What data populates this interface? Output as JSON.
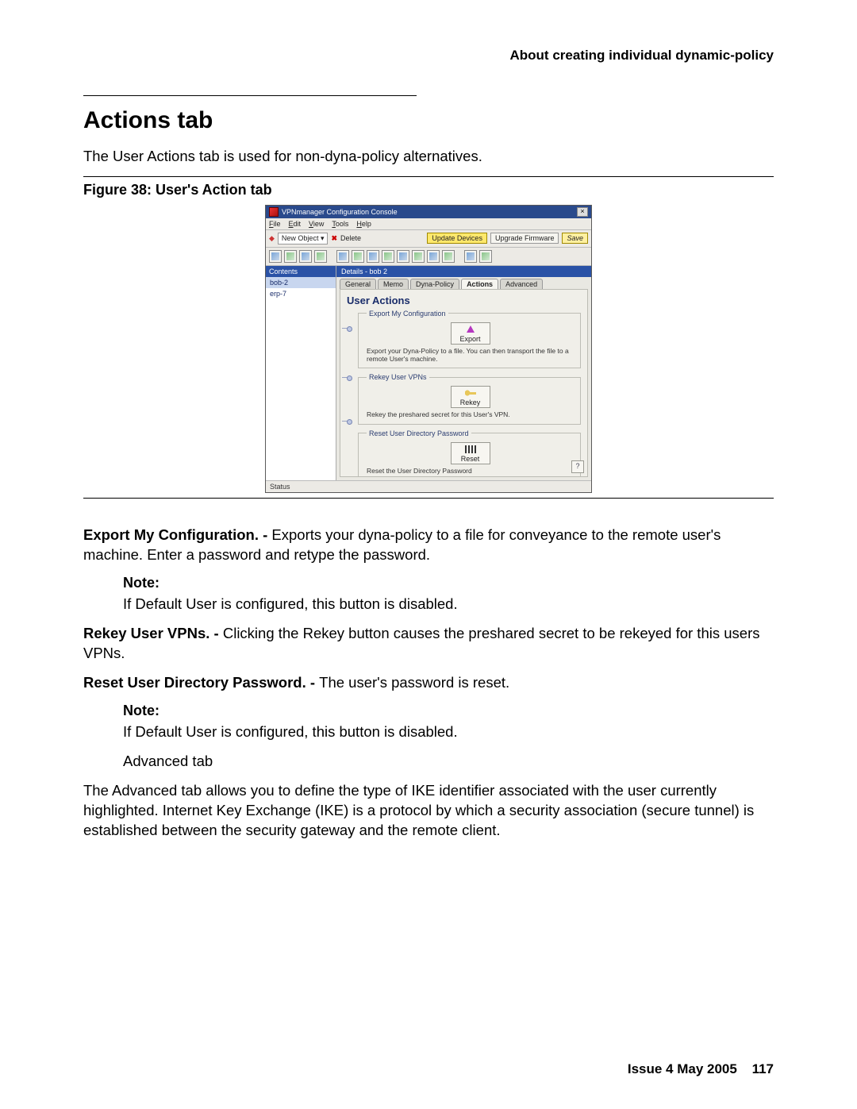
{
  "header": "About creating individual dynamic-policy",
  "title": "Actions tab",
  "intro": "The User Actions tab is used for non-dyna-policy alternatives.",
  "figure_caption": "Figure 38: User's Action tab",
  "export_label": "Export My Configuration. - ",
  "export_text": "Exports your dyna-policy to a file for conveyance to the remote user's machine. Enter a password and retype the password.",
  "note_label": "Note:",
  "note1_text": "If Default User is configured, this button is disabled.",
  "rekey_label": "Rekey User VPNs. - ",
  "rekey_text": "Clicking the Rekey button causes the preshared secret to be rekeyed for this users VPNs.",
  "reset_label": "Reset User Directory Password. - ",
  "reset_text": "The user's password is reset.",
  "note2_text": "If Default User is configured, this button is disabled.",
  "adv_heading": "Advanced tab",
  "adv_text": "The Advanced tab allows you to define the type of IKE identifier associated with the user currently highlighted. Internet Key Exchange (IKE) is a protocol by which a security association (secure tunnel) is established between the security gateway and the remote client.",
  "footer_issue": "Issue 4   May 2005",
  "footer_page": "117",
  "screenshot": {
    "window_title": "VPNmanager Configuration Console",
    "menu": [
      "File",
      "Edit",
      "View",
      "Tools",
      "Help"
    ],
    "toolbar1": {
      "new_object": "New Object",
      "delete": "Delete",
      "update_devices": "Update Devices",
      "upgrade_firmware": "Upgrade Firmware",
      "save": "Save"
    },
    "sidebar": {
      "heading": "Contents",
      "items": [
        "bob-2",
        "erp-7"
      ]
    },
    "details": {
      "heading": "Details - bob 2",
      "tabs": [
        "General",
        "Memo",
        "Dyna-Policy",
        "Actions",
        "Advanced"
      ],
      "active_tab": 3,
      "panel_title": "User Actions",
      "groups": {
        "export": {
          "legend": "Export My Configuration",
          "button": "Export",
          "desc": "Export your Dyna-Policy to a file. You can then transport the file to a remote User's machine."
        },
        "rekey": {
          "legend": "Rekey User VPNs",
          "button": "Rekey",
          "desc": "Rekey the preshared secret for this User's VPN."
        },
        "reset": {
          "legend": "Reset User Directory Password",
          "button": "Reset",
          "desc": "Reset the User Directory Password"
        }
      }
    },
    "status": "Status"
  }
}
